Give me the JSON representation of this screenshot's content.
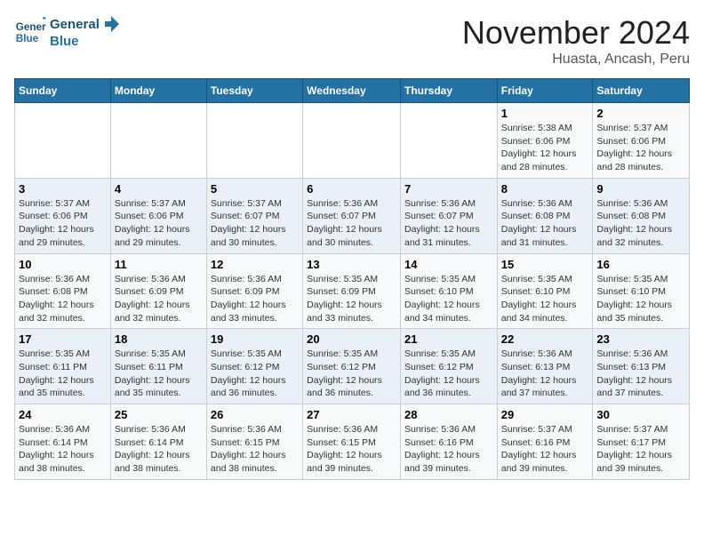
{
  "header": {
    "logo_line1": "General",
    "logo_line2": "Blue",
    "month_title": "November 2024",
    "location": "Huasta, Ancash, Peru"
  },
  "days_of_week": [
    "Sunday",
    "Monday",
    "Tuesday",
    "Wednesday",
    "Thursday",
    "Friday",
    "Saturday"
  ],
  "weeks": [
    [
      {
        "day": "",
        "info": ""
      },
      {
        "day": "",
        "info": ""
      },
      {
        "day": "",
        "info": ""
      },
      {
        "day": "",
        "info": ""
      },
      {
        "day": "",
        "info": ""
      },
      {
        "day": "1",
        "info": "Sunrise: 5:38 AM\nSunset: 6:06 PM\nDaylight: 12 hours and 28 minutes."
      },
      {
        "day": "2",
        "info": "Sunrise: 5:37 AM\nSunset: 6:06 PM\nDaylight: 12 hours and 28 minutes."
      }
    ],
    [
      {
        "day": "3",
        "info": "Sunrise: 5:37 AM\nSunset: 6:06 PM\nDaylight: 12 hours and 29 minutes."
      },
      {
        "day": "4",
        "info": "Sunrise: 5:37 AM\nSunset: 6:06 PM\nDaylight: 12 hours and 29 minutes."
      },
      {
        "day": "5",
        "info": "Sunrise: 5:37 AM\nSunset: 6:07 PM\nDaylight: 12 hours and 30 minutes."
      },
      {
        "day": "6",
        "info": "Sunrise: 5:36 AM\nSunset: 6:07 PM\nDaylight: 12 hours and 30 minutes."
      },
      {
        "day": "7",
        "info": "Sunrise: 5:36 AM\nSunset: 6:07 PM\nDaylight: 12 hours and 31 minutes."
      },
      {
        "day": "8",
        "info": "Sunrise: 5:36 AM\nSunset: 6:08 PM\nDaylight: 12 hours and 31 minutes."
      },
      {
        "day": "9",
        "info": "Sunrise: 5:36 AM\nSunset: 6:08 PM\nDaylight: 12 hours and 32 minutes."
      }
    ],
    [
      {
        "day": "10",
        "info": "Sunrise: 5:36 AM\nSunset: 6:08 PM\nDaylight: 12 hours and 32 minutes."
      },
      {
        "day": "11",
        "info": "Sunrise: 5:36 AM\nSunset: 6:09 PM\nDaylight: 12 hours and 32 minutes."
      },
      {
        "day": "12",
        "info": "Sunrise: 5:36 AM\nSunset: 6:09 PM\nDaylight: 12 hours and 33 minutes."
      },
      {
        "day": "13",
        "info": "Sunrise: 5:35 AM\nSunset: 6:09 PM\nDaylight: 12 hours and 33 minutes."
      },
      {
        "day": "14",
        "info": "Sunrise: 5:35 AM\nSunset: 6:10 PM\nDaylight: 12 hours and 34 minutes."
      },
      {
        "day": "15",
        "info": "Sunrise: 5:35 AM\nSunset: 6:10 PM\nDaylight: 12 hours and 34 minutes."
      },
      {
        "day": "16",
        "info": "Sunrise: 5:35 AM\nSunset: 6:10 PM\nDaylight: 12 hours and 35 minutes."
      }
    ],
    [
      {
        "day": "17",
        "info": "Sunrise: 5:35 AM\nSunset: 6:11 PM\nDaylight: 12 hours and 35 minutes."
      },
      {
        "day": "18",
        "info": "Sunrise: 5:35 AM\nSunset: 6:11 PM\nDaylight: 12 hours and 35 minutes."
      },
      {
        "day": "19",
        "info": "Sunrise: 5:35 AM\nSunset: 6:12 PM\nDaylight: 12 hours and 36 minutes."
      },
      {
        "day": "20",
        "info": "Sunrise: 5:35 AM\nSunset: 6:12 PM\nDaylight: 12 hours and 36 minutes."
      },
      {
        "day": "21",
        "info": "Sunrise: 5:35 AM\nSunset: 6:12 PM\nDaylight: 12 hours and 36 minutes."
      },
      {
        "day": "22",
        "info": "Sunrise: 5:36 AM\nSunset: 6:13 PM\nDaylight: 12 hours and 37 minutes."
      },
      {
        "day": "23",
        "info": "Sunrise: 5:36 AM\nSunset: 6:13 PM\nDaylight: 12 hours and 37 minutes."
      }
    ],
    [
      {
        "day": "24",
        "info": "Sunrise: 5:36 AM\nSunset: 6:14 PM\nDaylight: 12 hours and 38 minutes."
      },
      {
        "day": "25",
        "info": "Sunrise: 5:36 AM\nSunset: 6:14 PM\nDaylight: 12 hours and 38 minutes."
      },
      {
        "day": "26",
        "info": "Sunrise: 5:36 AM\nSunset: 6:15 PM\nDaylight: 12 hours and 38 minutes."
      },
      {
        "day": "27",
        "info": "Sunrise: 5:36 AM\nSunset: 6:15 PM\nDaylight: 12 hours and 39 minutes."
      },
      {
        "day": "28",
        "info": "Sunrise: 5:36 AM\nSunset: 6:16 PM\nDaylight: 12 hours and 39 minutes."
      },
      {
        "day": "29",
        "info": "Sunrise: 5:37 AM\nSunset: 6:16 PM\nDaylight: 12 hours and 39 minutes."
      },
      {
        "day": "30",
        "info": "Sunrise: 5:37 AM\nSunset: 6:17 PM\nDaylight: 12 hours and 39 minutes."
      }
    ]
  ]
}
